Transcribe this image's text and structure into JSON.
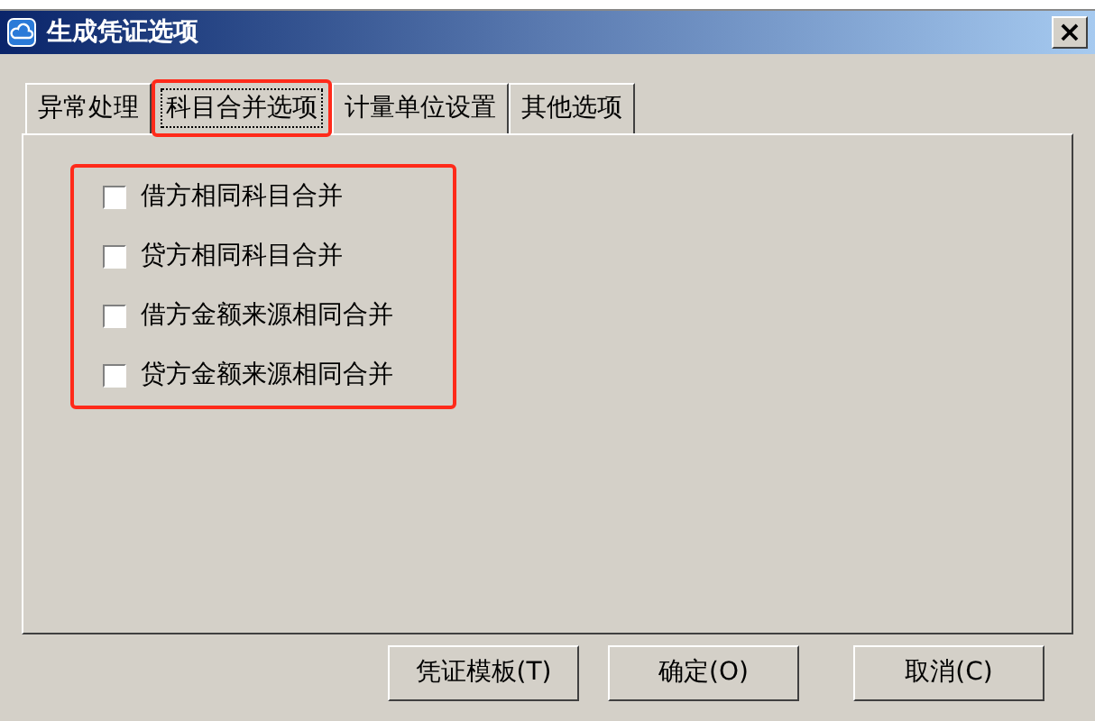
{
  "window": {
    "title": "生成凭证选项",
    "close": "×"
  },
  "tabs": [
    {
      "label": "异常处理",
      "selected": false
    },
    {
      "label": "科目合并选项",
      "selected": true
    },
    {
      "label": "计量单位设置",
      "selected": false
    },
    {
      "label": "其他选项",
      "selected": false
    }
  ],
  "options": [
    {
      "label": "借方相同科目合并",
      "checked": false
    },
    {
      "label": "贷方相同科目合并",
      "checked": false
    },
    {
      "label": "借方金额来源相同合并",
      "checked": false
    },
    {
      "label": "贷方金额来源相同合并",
      "checked": false
    }
  ],
  "buttons": [
    "凭证模板(T)",
    "确定(O)",
    "取消(C)"
  ]
}
